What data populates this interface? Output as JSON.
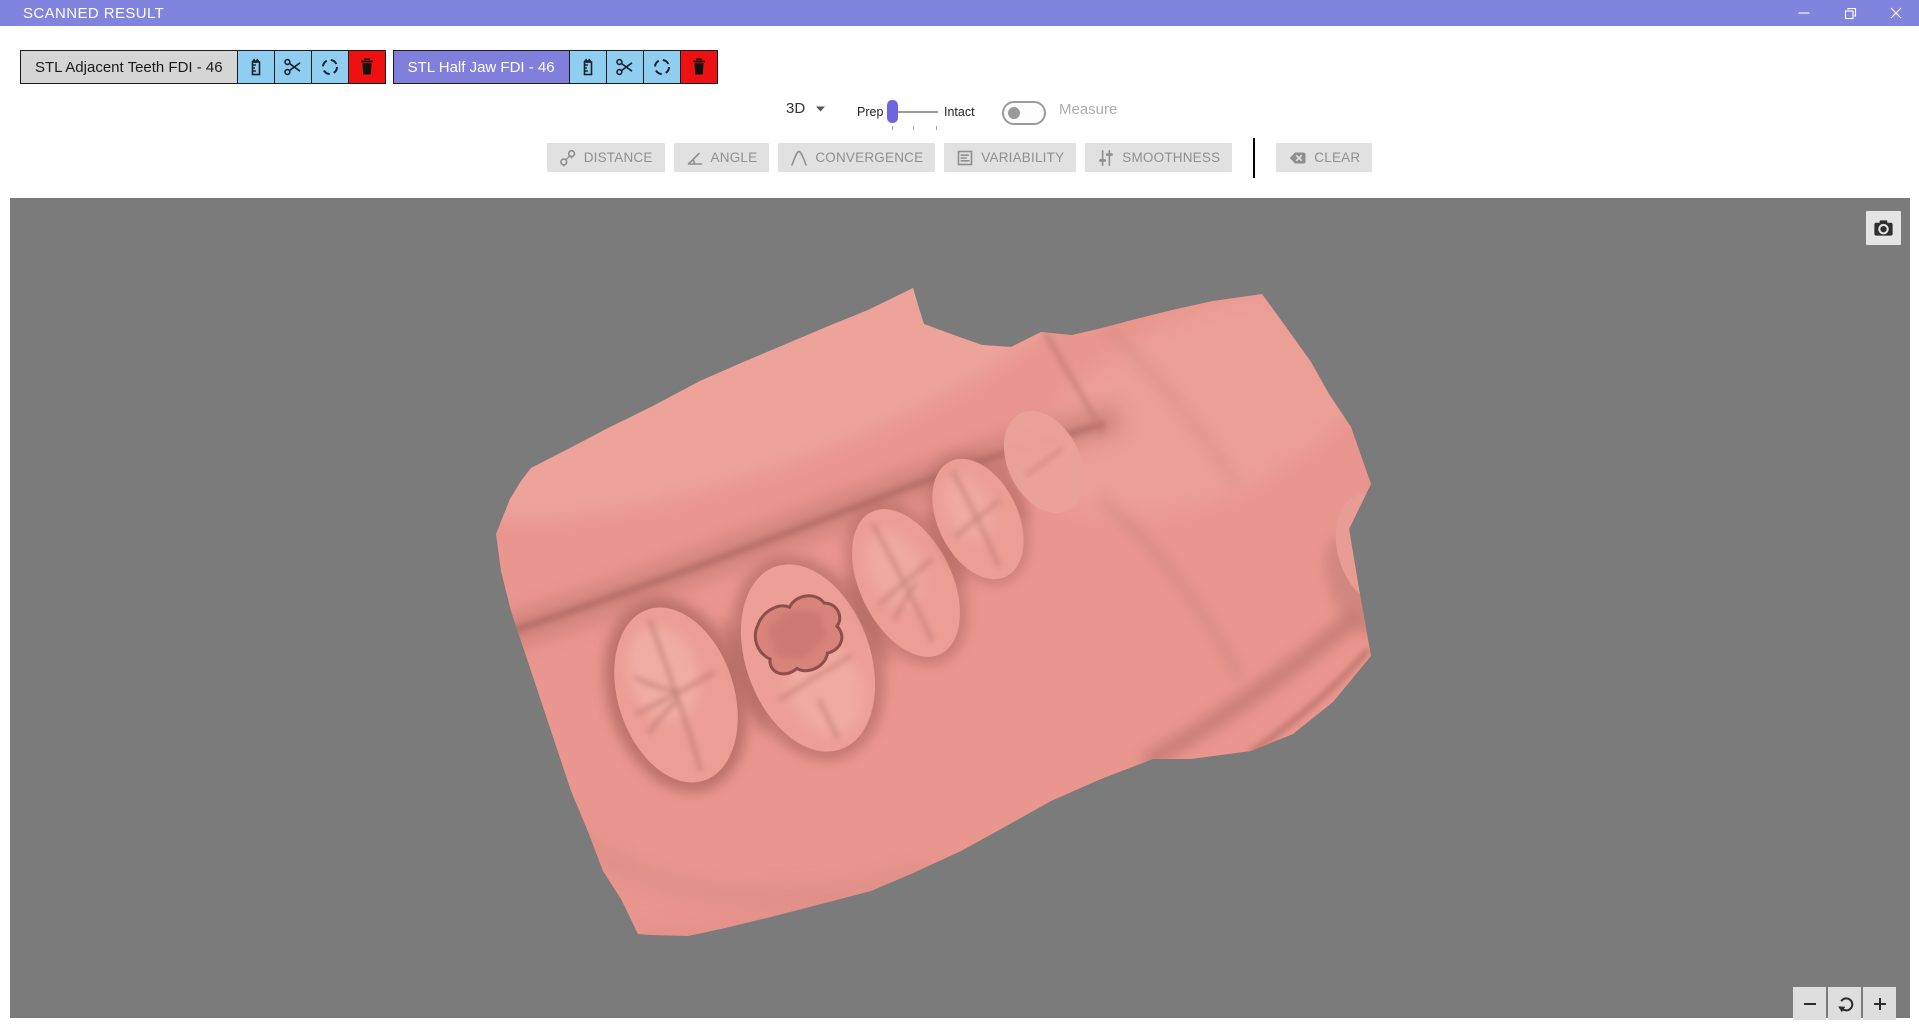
{
  "window": {
    "title": "SCANNED RESULT",
    "controls": [
      "minimize-icon",
      "restore-icon",
      "close-icon"
    ]
  },
  "chips": [
    {
      "label": "STL Adjacent Teeth FDI - 46",
      "style": "light",
      "buttons": [
        {
          "icon": "ruler-icon"
        },
        {
          "icon": "scissors-icon"
        },
        {
          "icon": "selection-marquee-icon"
        },
        {
          "icon": "delete-icon"
        }
      ]
    },
    {
      "label": "STL Half Jaw FDI - 46",
      "style": "purple",
      "buttons": [
        {
          "icon": "ruler-icon"
        },
        {
          "icon": "scissors-icon"
        },
        {
          "icon": "selection-marquee-icon"
        },
        {
          "icon": "delete-icon"
        }
      ]
    }
  ],
  "view_controls": {
    "mode_label": "3D",
    "mode_caret": "chevron-down-icon",
    "slider_left": "Prep",
    "slider_right": "Intact",
    "slider_position": "Prep",
    "measure_label": "Measure",
    "measure_enabled": false
  },
  "tools": [
    {
      "label": "DISTANCE",
      "icon": "distance-icon"
    },
    {
      "label": "ANGLE",
      "icon": "angle-icon"
    },
    {
      "label": "CONVERGENCE",
      "icon": "convergence-icon"
    },
    {
      "label": "VARIABILITY",
      "icon": "variability-icon"
    },
    {
      "label": "SMOOTHNESS",
      "icon": "smoothness-icon"
    }
  ],
  "clear_label": "CLEAR",
  "viewport": {
    "content": "pink dental half-jaw scan mesh with prepared molar cavity",
    "camera_button_icon": "camera-icon",
    "zoom_buttons": [
      "zoom-out-icon",
      "reset-view-icon",
      "zoom-in-icon"
    ]
  },
  "colors": {
    "titlebar": "#8184DF",
    "chip_purple": "#8080DC",
    "chip_gray": "#D5D5D5",
    "button_blue": "#8FCEF0",
    "button_red": "#ED1111",
    "toolbar_gray": "#E1E1E1",
    "canvas_gray": "#7B7B7B",
    "mesh_pink": "#E9968E",
    "slider_purple": "#6F66DA"
  }
}
